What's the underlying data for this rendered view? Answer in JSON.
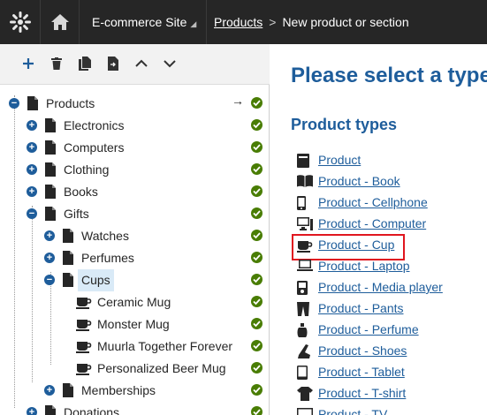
{
  "topbar": {
    "site_name": "E-commerce Site",
    "breadcrumb_link": "Products",
    "breadcrumb_sep": ">",
    "breadcrumb_current": "New product or section"
  },
  "toolbar": {
    "buttons": [
      "add-icon",
      "delete-icon",
      "copy-icon",
      "move-icon",
      "move-up-icon",
      "move-down-icon"
    ]
  },
  "tree": {
    "nodes": [
      {
        "label": "Products",
        "level": 0,
        "toggle": "−",
        "icon": "page-icon"
      },
      {
        "label": "Electronics",
        "level": 1,
        "toggle": "+",
        "icon": "page-icon"
      },
      {
        "label": "Computers",
        "level": 1,
        "toggle": "+",
        "icon": "page-icon"
      },
      {
        "label": "Clothing",
        "level": 1,
        "toggle": "+",
        "icon": "page-icon"
      },
      {
        "label": "Books",
        "level": 1,
        "toggle": "+",
        "icon": "page-icon"
      },
      {
        "label": "Gifts",
        "level": 1,
        "toggle": "−",
        "icon": "page-icon"
      },
      {
        "label": "Watches",
        "level": 2,
        "toggle": "+",
        "icon": "page-icon"
      },
      {
        "label": "Perfumes",
        "level": 2,
        "toggle": "+",
        "icon": "page-icon"
      },
      {
        "label": "Cups",
        "level": 2,
        "toggle": "−",
        "icon": "page-icon",
        "selected": true
      },
      {
        "label": "Ceramic Mug",
        "level": 3,
        "toggle": "",
        "icon": "cup-icon"
      },
      {
        "label": "Monster Mug",
        "level": 3,
        "toggle": "",
        "icon": "cup-icon"
      },
      {
        "label": "Muurla Together Forever",
        "level": 3,
        "toggle": "",
        "icon": "cup-icon"
      },
      {
        "label": "Personalized Beer Mug",
        "level": 3,
        "toggle": "",
        "icon": "cup-icon"
      },
      {
        "label": "Memberships",
        "level": 2,
        "toggle": "+",
        "icon": "page-icon"
      },
      {
        "label": "Donations",
        "level": 1,
        "toggle": "+",
        "icon": "page-icon"
      }
    ],
    "root_arrow": "→"
  },
  "main": {
    "title": "Please select a type",
    "subtitle": "Product types",
    "types": [
      {
        "label": "Product",
        "icon": "product-box-icon"
      },
      {
        "label": "Product - Book",
        "icon": "book-icon"
      },
      {
        "label": "Product - Cellphone",
        "icon": "cellphone-icon"
      },
      {
        "label": "Product - Computer",
        "icon": "computer-icon"
      },
      {
        "label": "Product - Cup",
        "icon": "cup-icon",
        "highlighted": true
      },
      {
        "label": "Product - Laptop",
        "icon": "laptop-icon"
      },
      {
        "label": "Product - Media player",
        "icon": "media-player-icon"
      },
      {
        "label": "Product - Pants",
        "icon": "pants-icon"
      },
      {
        "label": "Product - Perfume",
        "icon": "perfume-icon"
      },
      {
        "label": "Product - Shoes",
        "icon": "shoe-icon"
      },
      {
        "label": "Product - Tablet",
        "icon": "tablet-icon"
      },
      {
        "label": "Product - T-shirt",
        "icon": "tshirt-icon"
      },
      {
        "label": "Product - TV",
        "icon": "tv-icon"
      }
    ]
  },
  "colors": {
    "accent": "#1e5d9b",
    "status_published": "#497d04",
    "highlight_box": "#e0161f",
    "topbar_bg": "#262626"
  }
}
